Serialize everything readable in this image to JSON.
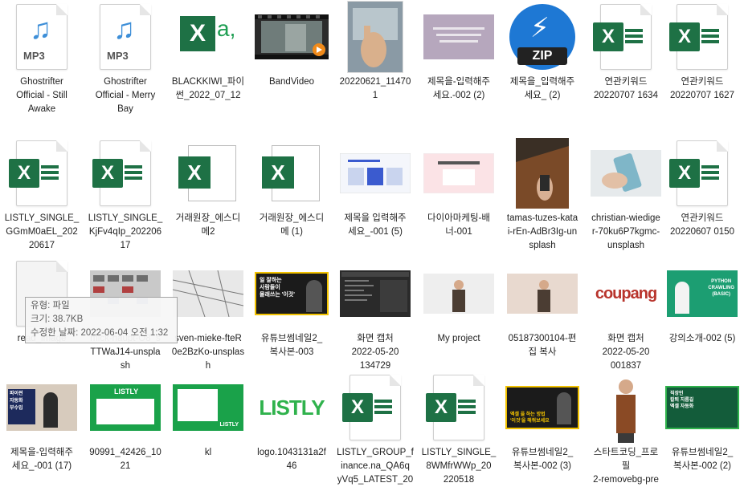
{
  "files": [
    {
      "label": "Ghostrifter\nOfficial - Still\nAwake",
      "icon": "mp3-icon",
      "mp3_text": "MP3"
    },
    {
      "label": "Ghostrifter\nOfficial - Merry\nBay",
      "icon": "mp3-icon",
      "mp3_text": "MP3"
    },
    {
      "label": "BLACKKIWI_파이\n썬_2022_07_12",
      "icon": "excel-csv-icon",
      "xl_letter": "X",
      "xl_a": "a,"
    },
    {
      "label": "BandVideo",
      "icon": "video-thumbnail"
    },
    {
      "label": "20220621_11470\n1",
      "icon": "photo-thumbnail"
    },
    {
      "label": "제목을-입력해주\n세요.-002 (2)",
      "icon": "image-thumbnail"
    },
    {
      "label": "제목을_입력해주\n세요_ (2)",
      "icon": "zip-icon",
      "zip_text": "ZIP"
    },
    {
      "label": "연관키워드\n20220707 1634",
      "icon": "excel-icon",
      "xl_letter": "X"
    },
    {
      "label": "연관키워드\n20220707 1627",
      "icon": "excel-icon",
      "xl_letter": "X"
    },
    {
      "label": "LISTLY_SINGLE_\nGGmM0aEL_202\n20617",
      "icon": "excel-icon",
      "xl_letter": "X"
    },
    {
      "label": "LISTLY_SINGLE_\nKjFv4qIp_202206\n17",
      "icon": "excel-icon",
      "xl_letter": "X"
    },
    {
      "label": "거래원장_에스디\n메2",
      "icon": "excel-doc-icon",
      "xl_letter": "X"
    },
    {
      "label": "거래원장_에스디\n메 (1)",
      "icon": "excel-doc-icon",
      "xl_letter": "X"
    },
    {
      "label": "제목을 입력해주\n세요_-001 (5)",
      "icon": "slide-thumbnail"
    },
    {
      "label": "다이아마케팅-배\n너-001",
      "icon": "slide-thumbnail"
    },
    {
      "label": "tamas-tuzes-kata\ni-rEn-AdBr3Ig-un\nsplash",
      "icon": "photo-thumbnail"
    },
    {
      "label": "christian-wiedige\nr-70ku6P7kgmc-\nunsplash",
      "icon": "photo-thumbnail"
    },
    {
      "label": "연관키워드\n20220607 0150",
      "icon": "excel-icon",
      "xl_letter": "X"
    },
    {
      "label": "read_image",
      "icon": "blank-file-icon"
    },
    {
      "label": "mick-haupt-O8_s\nTTWaJ14-unspla\nsh",
      "icon": "photo-thumbnail"
    },
    {
      "label": "sven-mieke-fteR\n0e2BzKo-unsplas\nh",
      "icon": "photo-thumbnail"
    },
    {
      "label": "유튜브썸네일2_\n복사본-003",
      "icon": "youtube-thumbnail",
      "thumb_text": "일 잘하는\n사람들이\n몰래쓰는 '이것'"
    },
    {
      "label": "화면 캡처\n2022-05-20\n134729",
      "icon": "screenshot-thumbnail"
    },
    {
      "label": "My project",
      "icon": "person-thumbnail"
    },
    {
      "label": "05187300104-편\n집 복사",
      "icon": "person-thumbnail"
    },
    {
      "label": "화면 캡처\n2022-05-20\n001837",
      "icon": "coupang-thumbnail",
      "thumb_text": "coupang"
    },
    {
      "label": "강의소개-002 (5)",
      "icon": "person-thumbnail",
      "thumb_text": "PYTHON\nCRAWLING\n(BASIC)"
    },
    {
      "label": "제목을-입력해주\n세요_-001 (17)",
      "icon": "person-thumbnail",
      "thumb_text": "파이썬\n자동화\n부수입"
    },
    {
      "label": "90991_42426_10\n21",
      "icon": "listly-thumbnail",
      "thumb_text": "LISTLY"
    },
    {
      "label": "kl",
      "icon": "listly-thumbnail",
      "thumb_text": "LISTLY"
    },
    {
      "label": "logo.1043131a2f\n46",
      "icon": "listly-logo",
      "thumb_text": "LISTLY"
    },
    {
      "label": "LISTLY_GROUP_f\ninance.na_QA6q\nyVq5_LATEST_20",
      "icon": "excel-icon",
      "xl_letter": "X"
    },
    {
      "label": "LISTLY_SINGLE_\n8WMfrWWp_20\n220518",
      "icon": "excel-icon",
      "xl_letter": "X"
    },
    {
      "label": "유튜브썸네일2_\n복사본-002 (3)",
      "icon": "youtube-thumbnail",
      "thumb_text": "엑셀 을 하는 방법\n'이것'을 해줘보세요"
    },
    {
      "label": "스타트코딩_프로\n필\n2-removebg-pre",
      "icon": "person-cutout"
    },
    {
      "label": "유튜브썸네일2_\n복사본-002 (2)",
      "icon": "youtube-thumbnail",
      "thumb_text": "직장인\n칼퇴 지름길\n엑셀 자동화"
    }
  ],
  "tooltip": {
    "type": "유형: 파일",
    "size": "크기: 38.7KB",
    "modified": "수정한 날짜: 2022-06-04 오전 1:32"
  },
  "colors": {
    "excel": "#1e7145",
    "zip": "#1e78d4",
    "mp3": "#3e8fd8",
    "listly": "#2fb24c"
  }
}
